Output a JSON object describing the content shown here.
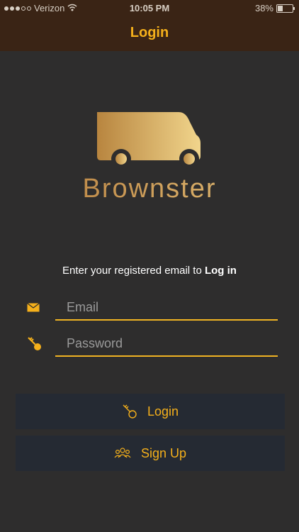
{
  "status_bar": {
    "carrier": "Verizon",
    "time": "10:05 PM",
    "battery": "38%"
  },
  "nav": {
    "title": "Login"
  },
  "brand": {
    "name": "Brownster"
  },
  "instruction": {
    "prefix": "Enter your registered email to ",
    "emphasis": "Log in"
  },
  "form": {
    "email_placeholder": "Email",
    "password_placeholder": "Password"
  },
  "buttons": {
    "login_label": "Login",
    "signup_label": "Sign Up"
  },
  "colors": {
    "accent": "#f5b01b",
    "background": "#2e2d2d",
    "header": "#3a2415",
    "button_bg": "#252a33"
  },
  "icons": [
    "wifi-icon",
    "battery-icon",
    "truck-logo",
    "mail-icon",
    "key-icon",
    "people-icon"
  ]
}
